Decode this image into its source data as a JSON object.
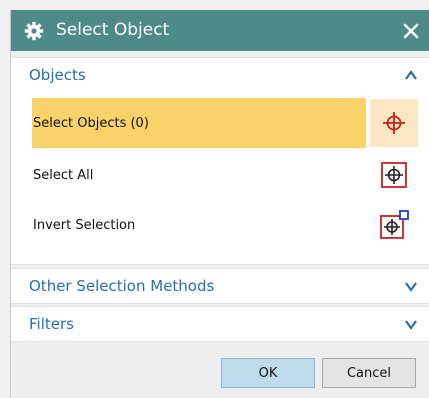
{
  "dialog": {
    "title": "Select Object",
    "gear_icon": "gear-icon",
    "close_icon": "close-icon",
    "title_bg": "#4e8a88"
  },
  "objects_section": {
    "title": "Objects",
    "expanded": true,
    "rows": [
      {
        "label": "Select Objects (0)",
        "selected": true,
        "icon": "crosshair-select-icon"
      },
      {
        "label": "Select All",
        "selected": false,
        "icon": "select-all-icon"
      },
      {
        "label": "Invert Selection",
        "selected": false,
        "icon": "invert-selection-icon"
      }
    ]
  },
  "other_methods_section": {
    "title": "Other Selection Methods",
    "expanded": false
  },
  "filters_section": {
    "title": "Filters",
    "expanded": false
  },
  "footer": {
    "ok_label": "OK",
    "cancel_label": "Cancel"
  },
  "colors": {
    "section_title": "#2a6fb0",
    "selected_row": "#fad26a",
    "accent_red": "#cc1f1f"
  }
}
